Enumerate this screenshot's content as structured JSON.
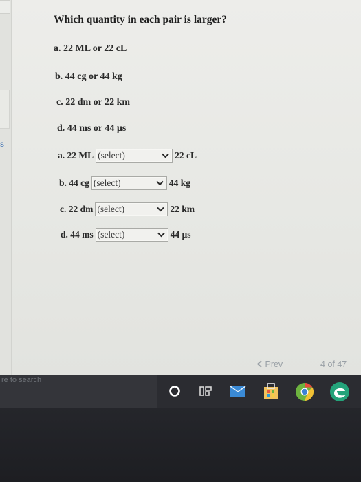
{
  "question": "Which quantity in each pair is larger?",
  "items": [
    "a. 22 ML or 22 cL",
    "b. 44 cg or 44 kg",
    "c. 22 dm or 22 km",
    "d. 44 ms or 44 µs"
  ],
  "answers": [
    {
      "left": "a. 22 ML",
      "select": "(select)",
      "right": "22 cL"
    },
    {
      "left": "b. 44 cg",
      "select": "(select)",
      "right": "44 kg"
    },
    {
      "left": "c. 22 dm",
      "select": "(select)",
      "right": "22 km"
    },
    {
      "left": "d. 44 ms",
      "select": "(select)",
      "right": "44 µs"
    }
  ],
  "pagination": {
    "prev_label": "Prev",
    "prev_icon": "chevron-left-icon",
    "current": "4",
    "of_text": "of 47"
  },
  "taskbar": {
    "search_text": "re to search"
  },
  "left_edge_text": "s",
  "colors": {
    "link": "#99a0a6",
    "taskbar": "#2b2c31",
    "text": "#2a2a2a"
  }
}
